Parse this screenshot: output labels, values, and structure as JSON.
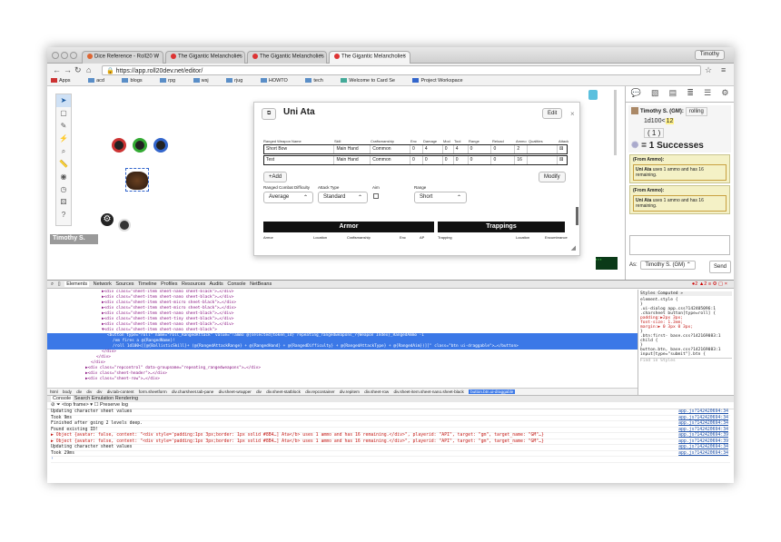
{
  "browser": {
    "tabs": [
      "Dice Reference - Roll20 W",
      "The Gigantic Melancholies",
      "The Gigantic Melancholies",
      "The Gigantic Melancholies"
    ],
    "user": "Timothy",
    "url": "https://app.roll20dev.net/editor/",
    "bookmarks": [
      "Apps",
      "acd",
      "blogs",
      "rpg",
      "wsj",
      "rjug",
      "HOWTO",
      "tech",
      "Welcome to Card Se",
      "Project Workspace"
    ]
  },
  "vtt": {
    "player_name": "Timothy S."
  },
  "sheet": {
    "title": "Uni Ata",
    "edit": "Edit",
    "headers": [
      "Ranged Weapon Name",
      "Skill",
      "Craftsmanship",
      "Enc",
      "Damage",
      "Mod",
      "Tool",
      "Range",
      "Reload",
      "Ammo",
      "Qualities",
      "Attack"
    ],
    "rows": [
      [
        "Short Bow",
        "Main Hand",
        "Common",
        "0",
        "4",
        "0",
        "4",
        "0",
        "0",
        "2",
        ""
      ],
      [
        "Test",
        "Main Hand",
        "Common",
        "0",
        "0",
        "0",
        "0",
        "0",
        "0",
        "16",
        ""
      ]
    ],
    "add": "+Add",
    "modify": "Modify",
    "labels": [
      "Ranged Combat Difficulty",
      "Attack Type",
      "Aim",
      "Range"
    ],
    "values": [
      "Average",
      "Standard",
      "",
      "Short"
    ],
    "sections": [
      "Armor",
      "Trappings"
    ],
    "armor_cols": [
      "Armor",
      "Location",
      "Craftsmanship",
      "Enc",
      "AP"
    ],
    "trap_cols": [
      "Trapping",
      "Location",
      "Encumbrance"
    ]
  },
  "chat": {
    "sender": "Timothy S. (GM):",
    "text": "rolling",
    "formula": "1d100<",
    "target": "12",
    "roll": "1",
    "result": "= 1 Successes",
    "ammo_from": "(From Ammo):",
    "ammo_name": "Uni Ata",
    "ammo_text": " uses 1 ammo and has 16 remaining.",
    "as_label": "As:",
    "as_value": "Timothy S. (GM)",
    "send": "Send"
  },
  "devtools": {
    "tabs": [
      "Elements",
      "Network",
      "Sources",
      "Timeline",
      "Profiles",
      "Resources",
      "Audits",
      "Console",
      "NetBeans"
    ],
    "dom": [
      "▶<div class=\"sheet-item sheet-nano sheet-black\">…</div>",
      "▶<div class=\"sheet-item sheet-nano sheet-black\">…</div>",
      "▶<div class=\"sheet-item sheet-micro sheet-black\">…</div>",
      "▶<div class=\"sheet-item sheet-micro sheet-black\">…</div>",
      "▶<div class=\"sheet-item sheet-nano sheet-black\">…</div>",
      "▶<div class=\"sheet-item sheet-tiny sheet-black\">…</div>",
      "▶<div class=\"sheet-item sheet-nano sheet-black\">…</div>",
      "▼<div class=\"sheet-item sheet-nano sheet-black\">",
      "<button type=\"roll\" name=\"roll_RangedAttack\" value=\"!ammo @{selected|token_id} repeating_rangedweapons_?{Weapon Index}_RangedAmmo -1",
      "/em fires a @{RangedName}!",
      "/roll 1d100<[[@{BallisticSkill}+ (@{RangedAttackRange} + @{RangedHand} + @{RangedDifficulty} + @{RangedAttackType} + @{RangedAim})]]\" class=\"btn ui-draggable\">…</button>",
      "</div>",
      "</div>",
      "</div>",
      "▶<div class=\"repcontrol\" data-groupname=\"repeating_rangedweapons\">…</div>",
      "▶<div class=\"sheet-header\">…</div>",
      "▶<div class=\"sheet-row\">…</div>"
    ],
    "styles_tabs": "Styles  Computed  »",
    "styles": [
      "element.style {",
      "}",
      ".ui-dialog   app.css?142405096:1",
      ".charsheet button[type=roll] {",
      "  padding:▶2px 3px;",
      "  font-size: 1.3em;",
      "  margin:▶ 0 3px 0 3px;",
      "}",
      ".btn:first- base.css?142169083:1",
      "child {",
      "}",
      "button.btn, base.css?142169083:1",
      "input[type=\"submit\"].btn {",
      "Find in Styles"
    ],
    "crumbs": [
      "html",
      "body",
      "div",
      "div",
      "div",
      "div.tab-content",
      "form.sheetform",
      "div.charsheet.tab-pane",
      "div.sheet-wrapper",
      "div",
      "div.sheet-statblock",
      "div.repcontainer",
      "div.repitem",
      "div.sheet-row",
      "div.sheet-item.sheet-nano.sheet-black",
      "button.btn.ui-draggable"
    ],
    "console_tabs": [
      "Console",
      "Search",
      "Emulation",
      "Rendering"
    ],
    "frame": "<top frame>",
    "preserve": "Preserve log",
    "console": [
      [
        "Updating character sheet values",
        "app.js?142420694:34"
      ],
      [
        "Took 9ms",
        "app.js?142420694:34"
      ],
      [
        "Finished after going 2 levels deep.",
        "app.js?142420694:34"
      ],
      [
        "Found existing ID!",
        "app.js?142420694:34"
      ],
      [
        "▶ Object {avatar: false, content: \"<div style='padding:1px 3px;border: 1px solid #8B4…] Ata</b> uses 1 ammo and has 16 remaining.</div>\", playerid: \"API\", target: \"gm\", target_name: \"GM\"…}",
        "app.js?142420694:39"
      ],
      [
        "▶ Object {avatar: false, content: \"<div style='padding:1px 3px;border: 1px solid #8B4…] Ata</b> uses 1 ammo and has 16 remaining.</div>\", playerid: \"API\", target: \"gm\", target_name: \"GM\"…}",
        "app.js?142420694:39"
      ],
      [
        "Updating character sheet values",
        "app.js?142420694:34"
      ],
      [
        "Took 29ms",
        "app.js?142420694:34"
      ]
    ]
  }
}
